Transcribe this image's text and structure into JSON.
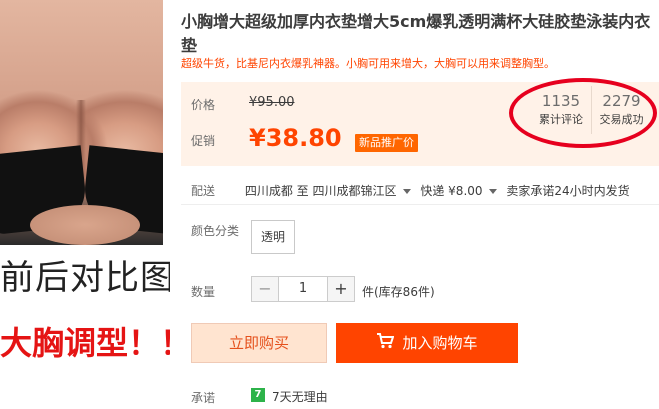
{
  "image": {
    "caption_line1": "前后对比图",
    "caption_line2": "大胸调型！！"
  },
  "product": {
    "title": "小胸增大超级加厚内衣垫增大5cm爆乳透明满杯大硅胶垫泳装内衣垫",
    "subtitle": "超级牛货，比基尼内衣爆乳神器。小胸可用来增大，大胸可以用来调整胸型。"
  },
  "price": {
    "orig_label": "价格",
    "orig_value": "¥95.00",
    "promo_label": "促销",
    "promo_value": "¥38.80",
    "promo_badge": "新品推广价"
  },
  "stats": {
    "reviews_count": "1135",
    "reviews_label": "累计评论",
    "sales_count": "2279",
    "sales_label": "交易成功"
  },
  "shipping": {
    "label": "配送",
    "from": "四川成都",
    "to_word": "至",
    "to": "四川成都锦江区",
    "method": "快递 ¥8.00",
    "promise": "卖家承诺24小时内发货"
  },
  "options": {
    "color_label": "颜色分类",
    "color_value": "透明"
  },
  "quantity": {
    "label": "数量",
    "minus": "−",
    "value": "1",
    "plus": "+",
    "stock": "件(库存86件)"
  },
  "actions": {
    "buy_now": "立即购买",
    "add_to_cart": "加入购物车"
  },
  "promise": {
    "label": "承诺",
    "badge": "7",
    "text": "7天无理由"
  },
  "colors": {
    "accent": "#ff4400",
    "annotation": "#e6001e",
    "price_bg": "#fff2e8"
  }
}
